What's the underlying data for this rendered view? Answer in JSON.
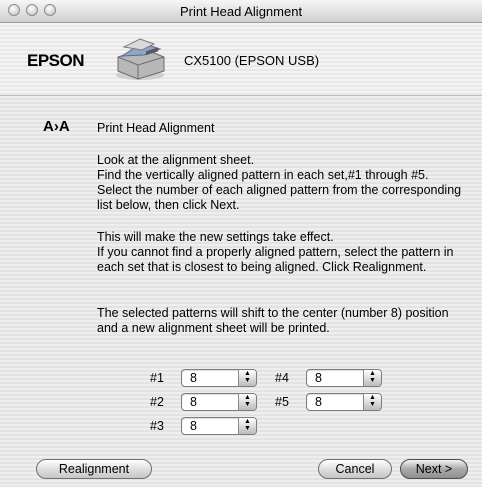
{
  "window": {
    "title": "Print Head Alignment"
  },
  "header": {
    "logo": "EPSON",
    "device": "CX5100 (EPSON USB)",
    "icon": "printer-icon"
  },
  "main": {
    "section_icon": "A›A",
    "section_title": "Print Head Alignment",
    "para1": [
      "Look at the alignment sheet.",
      "Find the vertically aligned pattern in each set,#1 through #5.",
      "Select the number of each aligned pattern from the corresponding",
      "list below, then click Next."
    ],
    "para2": [
      "This will make the new settings take effect.",
      "If you cannot find a properly aligned pattern, select the pattern in",
      "each set that is closest to being aligned. Click Realignment."
    ],
    "para3": [
      "The selected patterns will shift to the center (number 8) position",
      "and a new alignment sheet will be printed."
    ]
  },
  "patterns": [
    {
      "label": "#1",
      "value": "8"
    },
    {
      "label": "#2",
      "value": "8"
    },
    {
      "label": "#3",
      "value": "8"
    },
    {
      "label": "#4",
      "value": "8"
    },
    {
      "label": "#5",
      "value": "8"
    }
  ],
  "buttons": {
    "realignment": "Realignment",
    "cancel": "Cancel",
    "next": "Next >"
  }
}
